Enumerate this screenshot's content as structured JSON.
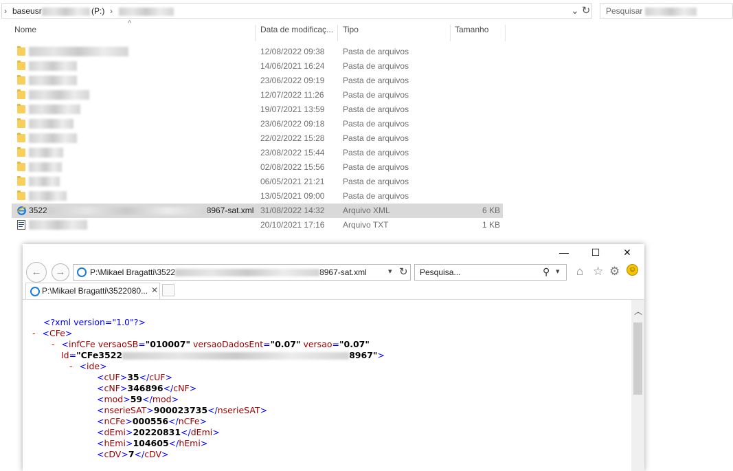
{
  "explorer": {
    "breadcrumb": {
      "root": "baseusr",
      "drive": "(P:)"
    },
    "search_placeholder": "Pesquisar",
    "columns": {
      "name": "Nome",
      "date": "Data de modificaç...",
      "type": "Tipo",
      "size": "Tamanho"
    },
    "folder_rows": [
      {
        "date": "12/08/2022 09:38",
        "type": "Pasta de arquivos"
      },
      {
        "date": "14/06/2021 16:24",
        "type": "Pasta de arquivos"
      },
      {
        "date": "23/06/2022 09:19",
        "type": "Pasta de arquivos"
      },
      {
        "date": "12/07/2022 11:26",
        "type": "Pasta de arquivos"
      },
      {
        "date": "19/07/2021 13:59",
        "type": "Pasta de arquivos"
      },
      {
        "date": "23/06/2022 09:18",
        "type": "Pasta de arquivos"
      },
      {
        "date": "22/02/2022 15:28",
        "type": "Pasta de arquivos"
      },
      {
        "date": "23/08/2022 15:44",
        "type": "Pasta de arquivos"
      },
      {
        "date": "02/08/2022 15:56",
        "type": "Pasta de arquivos"
      },
      {
        "date": "06/05/2021 21:21",
        "type": "Pasta de arquivos"
      },
      {
        "date": "13/05/2021 09:00",
        "type": "Pasta de arquivos"
      }
    ],
    "xml_file": {
      "name_start": "3522",
      "name_end": "8967-sat.xml",
      "date": "31/08/2022 14:32",
      "type": "Arquivo XML",
      "size": "6 KB"
    },
    "txt_file": {
      "date": "20/10/2021 17:16",
      "type": "Arquivo TXT",
      "size": "1 KB"
    }
  },
  "ie": {
    "window_controls": {
      "minimize": "—",
      "maximize": "☐",
      "close": "✕"
    },
    "url_start": "P:\\Mikael Bragatti\\3522",
    "url_end": "8967-sat.xml",
    "search_placeholder": "Pesquisa...",
    "tab_label": "P:\\Mikael Bragatti\\3522080...",
    "icons": [
      "back-icon",
      "forward-icon",
      "refresh-icon",
      "search-icon",
      "home-icon",
      "star-icon",
      "gear-icon",
      "smiley-icon"
    ]
  },
  "xml": {
    "decl": "<?xml version=\"1.0\"?>",
    "cfe_open": "<CFe>",
    "infcfe": {
      "tag": "infCFe",
      "attr1_name": "versaoSB",
      "attr1_val": "\"010007\"",
      "attr2_name": "versaoDadosEnt",
      "attr2_val": "\"0.07\"",
      "attr3_name": "versao",
      "attr3_val": "\"0.07\"",
      "id_name": "Id",
      "id_val_start": "\"CFe3522",
      "id_val_end": "8967\""
    },
    "ide_tag": "ide",
    "fields": [
      {
        "tag": "cUF",
        "value": "35"
      },
      {
        "tag": "cNF",
        "value": "346896"
      },
      {
        "tag": "mod",
        "value": "59"
      },
      {
        "tag": "nserieSAT",
        "value": "900023735"
      },
      {
        "tag": "nCFe",
        "value": "000556"
      },
      {
        "tag": "dEmi",
        "value": "20220831"
      },
      {
        "tag": "hEmi",
        "value": "104605"
      },
      {
        "tag": "cDV",
        "value": "7"
      }
    ]
  }
}
